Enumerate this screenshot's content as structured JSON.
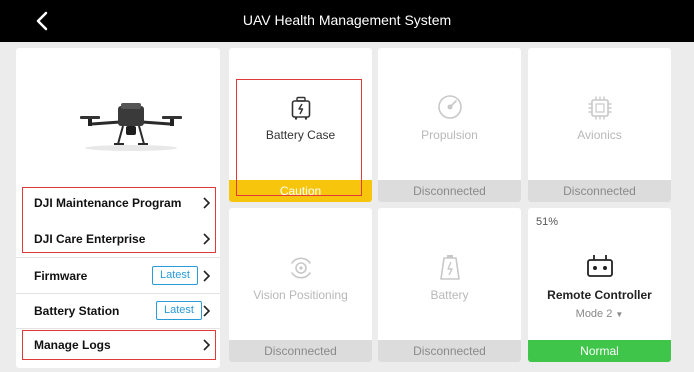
{
  "header": {
    "title": "UAV Health Management System"
  },
  "menu": {
    "maintenance": "DJI Maintenance Program",
    "care": "DJI Care Enterprise",
    "firmware": "Firmware",
    "firmware_badge": "Latest",
    "battery_station": "Battery Station",
    "battery_station_badge": "Latest",
    "logs": "Manage Logs"
  },
  "tiles": {
    "battery_case": {
      "label": "Battery Case",
      "status": "Caution"
    },
    "propulsion": {
      "label": "Propulsion",
      "status": "Disconnected"
    },
    "avionics": {
      "label": "Avionics",
      "status": "Disconnected"
    },
    "vision": {
      "label": "Vision Positioning",
      "status": "Disconnected"
    },
    "battery": {
      "label": "Battery",
      "status": "Disconnected"
    },
    "remote": {
      "label": "Remote Controller",
      "percent": "51%",
      "mode": "Mode 2",
      "status": "Normal"
    }
  },
  "colors": {
    "caution": "#f6c50c",
    "normal": "#3ec54a",
    "disconnected": "#dcdcdc",
    "highlight": "#e23a3a",
    "badge": "#2a9bd9"
  }
}
